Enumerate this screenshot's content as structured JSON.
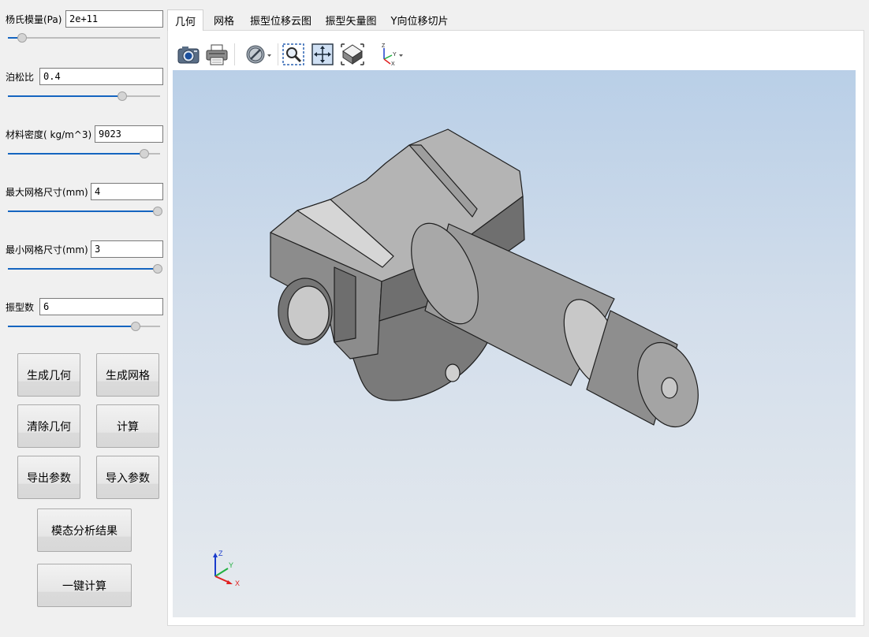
{
  "params": {
    "youngs_modulus": {
      "label": "杨氏模量(Pa)",
      "value": "2e+11",
      "slider_fraction": 0.08
    },
    "poisson_ratio": {
      "label": "泊松比",
      "value": "0.4",
      "slider_fraction": 0.76
    },
    "density": {
      "label": "材料密度( kg/m^3)",
      "value": "9023",
      "slider_fraction": 0.91
    },
    "max_mesh": {
      "label": "最大网格尺寸(mm)",
      "value": "4",
      "slider_fraction": 1.0
    },
    "min_mesh": {
      "label": "最小网格尺寸(mm)",
      "value": "3",
      "slider_fraction": 1.0
    },
    "mode_count": {
      "label": "振型数",
      "value": "6",
      "slider_fraction": 0.85
    }
  },
  "buttons": {
    "generate_geometry": "生成几何",
    "generate_mesh": "生成网格",
    "clear_geometry": "清除几何",
    "compute": "计算",
    "export_params": "导出参数",
    "import_params": "导入参数",
    "modal_results": "模态分析结果",
    "one_click_compute": "一键计算"
  },
  "tabs": [
    "几何",
    "网格",
    "振型位移云图",
    "振型矢量图",
    "Y向位移切片"
  ],
  "active_tab": 0,
  "toolbar_icons": [
    "camera-icon",
    "printer-icon",
    "display-mode-icon",
    "zoom-box-icon",
    "fit-all-icon",
    "iso-view-icon",
    "axes-view-icon"
  ],
  "axis_triad": {
    "x": "X",
    "y": "Y",
    "z": "Z"
  },
  "colors": {
    "slider_fill": "#1565c0",
    "axis_x": "#e02020",
    "axis_y": "#20b040",
    "axis_z": "#1a3ccc",
    "part": "#8a8a8a"
  }
}
